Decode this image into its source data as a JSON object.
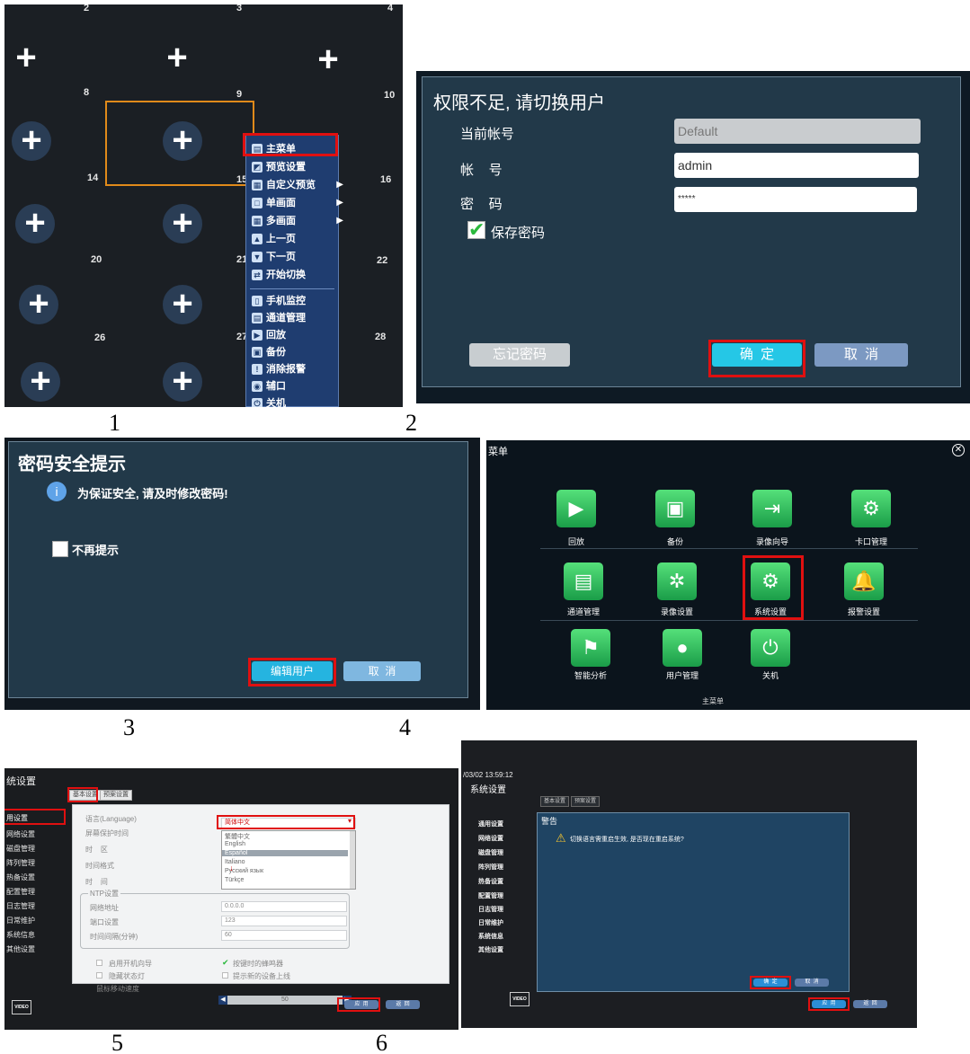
{
  "steps": [
    "1",
    "2",
    "3",
    "4",
    "5",
    "6"
  ],
  "panel1": {
    "channels": [
      "2",
      "3",
      "4",
      "8",
      "9",
      "10",
      "14",
      "15",
      "16",
      "20",
      "21",
      "22",
      "26",
      "27",
      "28"
    ],
    "menu": [
      {
        "label": "主菜单",
        "icon": "menu-icon"
      },
      {
        "label": "预览设置",
        "icon": "preview-icon"
      },
      {
        "label": "自定义预览",
        "icon": "custom-icon",
        "submenu": true
      },
      {
        "label": "单画面",
        "icon": "single-screen-icon",
        "submenu": true
      },
      {
        "label": "多画面",
        "icon": "multi-screen-icon",
        "submenu": true
      },
      {
        "label": "上一页",
        "icon": "arrow-up-icon"
      },
      {
        "label": "下一页",
        "icon": "arrow-down-icon"
      },
      {
        "label": "开始切换",
        "icon": "switch-icon"
      },
      {
        "label": "手机监控",
        "icon": "phone-icon"
      },
      {
        "label": "通道管理",
        "icon": "channel-icon"
      },
      {
        "label": "回放",
        "icon": "playback-icon"
      },
      {
        "label": "备份",
        "icon": "backup-icon"
      },
      {
        "label": "消除报警",
        "icon": "alarm-icon"
      },
      {
        "label": "辅口",
        "icon": "aux-icon"
      },
      {
        "label": "关机",
        "icon": "power-icon"
      }
    ]
  },
  "panel2": {
    "title": "权限不足, 请切换用户",
    "current_account_label": "当前帐号",
    "current_account_value": "Default",
    "account_label": "帐    号",
    "account_value": "admin",
    "password_label": "密    码",
    "password_value": "*****",
    "save_password_label": "保存密码",
    "forgot_label": "忘记密码",
    "ok_label": "确  定",
    "cancel_label": "取  消"
  },
  "panel3": {
    "title": "密码安全提示",
    "message": "为保证安全, 请及时修改密码!",
    "no_remind_label": "不再提示",
    "edit_user_label": "编辑用户",
    "cancel_label": "取  消"
  },
  "panel4": {
    "title": "菜单",
    "footer": "主菜单",
    "tiles": [
      {
        "label": "回放",
        "glyph": "▶"
      },
      {
        "label": "备份",
        "glyph": "▣"
      },
      {
        "label": "录像向导",
        "glyph": "⇥"
      },
      {
        "label": "卡口管理",
        "glyph": "⚙"
      },
      {
        "label": "通道管理",
        "glyph": "▤"
      },
      {
        "label": "录像设置",
        "glyph": "✲"
      },
      {
        "label": "系统设置",
        "glyph": "⚙"
      },
      {
        "label": "报警设置",
        "glyph": "🔔"
      },
      {
        "label": "智能分析",
        "glyph": "⚑"
      },
      {
        "label": "用户管理",
        "glyph": "●"
      },
      {
        "label": "关机",
        "glyph": "⏻"
      }
    ]
  },
  "panel5": {
    "title": "统设置",
    "tabs": [
      "基本设置",
      "预案设置"
    ],
    "sidebar": [
      "用设置",
      "网络设置",
      "磁盘管理",
      "阵列管理",
      "热备设置",
      "配置管理",
      "日志管理",
      "日常维护",
      "系统信息",
      "其他设置"
    ],
    "fields": [
      {
        "label": "语言(Language)",
        "value": "简体中文"
      },
      {
        "label": "屏幕保护时间",
        "value": ""
      },
      {
        "label": "时    区",
        "value": ""
      },
      {
        "label": "时间格式",
        "value": ""
      },
      {
        "label": "时    间",
        "value": ""
      }
    ],
    "language_options": [
      "繁體中文",
      "English",
      "Español",
      "Italiano",
      "Русский язык",
      "Türkçe"
    ],
    "ntp": {
      "section_label": "NTP设置",
      "server_label": "网络地址",
      "server_value": "0.0.0.0",
      "port_label": "端口设置",
      "port_value": "123",
      "interval_label": "时间间隔(分钟)",
      "interval_value": "60"
    },
    "options": [
      "启用开机向导",
      "隐藏状态灯",
      "鼠标移动速度"
    ],
    "options_right": [
      "按键时的蜂鸣器",
      "提示新的设备上线"
    ],
    "slider_value": "50",
    "apply_label": "应  用",
    "back_label": "返  回",
    "logo": "VIDEO"
  },
  "panel6": {
    "timestamp": "/03/02 13:59:12",
    "title": "系统设置",
    "tabs": [
      "基本设置",
      "预案设置"
    ],
    "sidebar": [
      "通用设置",
      "网络设置",
      "磁盘管理",
      "阵列管理",
      "热备设置",
      "配置管理",
      "日志管理",
      "日常维护",
      "系统信息",
      "其他设置"
    ],
    "warning_title": "警告",
    "warning_message": "切换语言需重启生效, 是否现在重启系统?",
    "confirm_label": "确  定",
    "cancel_label": "取  消",
    "apply_label": "应  用",
    "back_label": "返  回",
    "logo": "VIDEO"
  },
  "colors": {
    "highlight": "#e01010",
    "menu_bg": "#1f3d70",
    "tile_green": "#1a9d48",
    "dialog_bg": "#223949",
    "accent_button": "#25c7e6"
  }
}
